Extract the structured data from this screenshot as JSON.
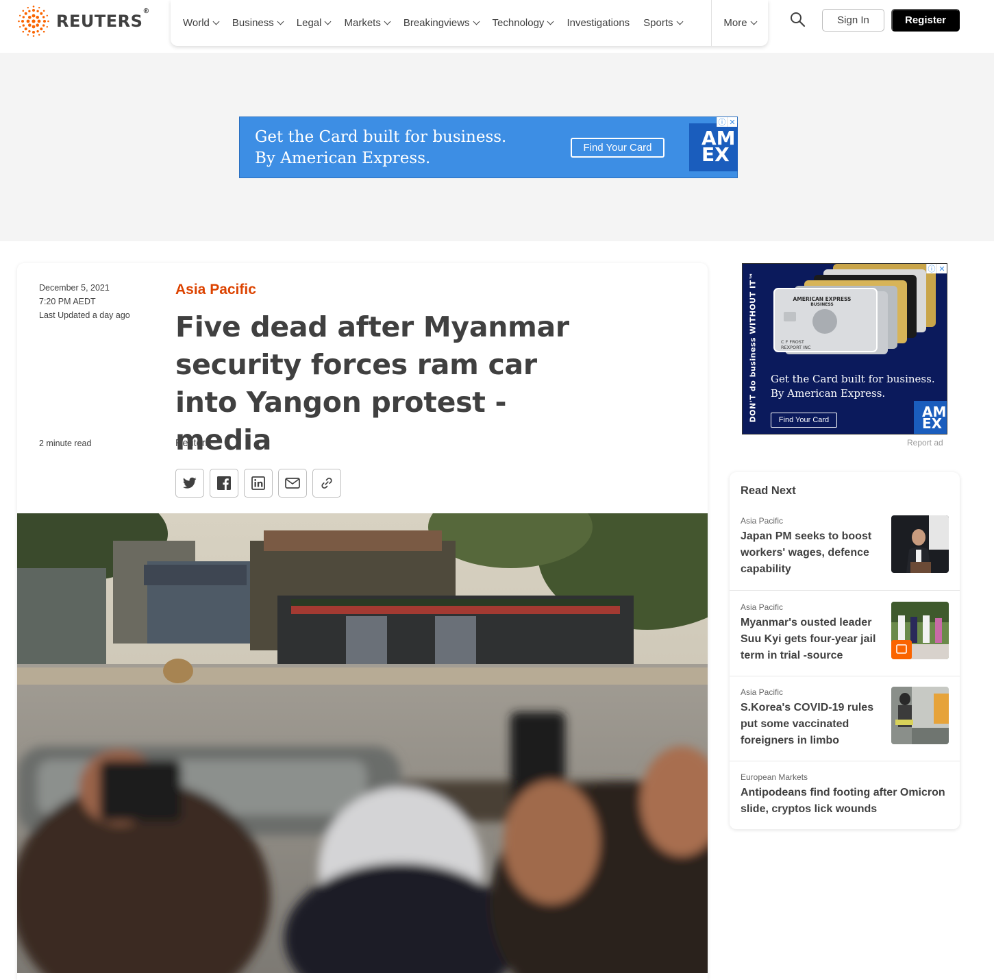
{
  "header": {
    "brand": "REUTERS",
    "brand_mark": "®",
    "nav": [
      "World",
      "Business",
      "Legal",
      "Markets",
      "Breakingviews",
      "Technology",
      "Investigations",
      "Sports"
    ],
    "nav_chevrons": [
      true,
      true,
      true,
      true,
      true,
      true,
      false,
      true
    ],
    "more_label": "More",
    "sign_in": "Sign In",
    "register": "Register"
  },
  "top_ad": {
    "line1": "Get the Card built for business.",
    "line2": "By American Express.",
    "cta": "Find Your Card",
    "logo_line1": "AM",
    "logo_line2": "EX"
  },
  "article": {
    "date": "December 5, 2021",
    "time": "7:20 PM AEDT",
    "updated": "Last Updated a day ago",
    "kicker": "Asia Pacific",
    "headline": "Five dead after Myanmar security forces ram car into Yangon protest - media",
    "read_time": "2 minute read",
    "byline": "Reuters",
    "share": [
      "twitter-icon",
      "facebook-icon",
      "linkedin-icon",
      "email-icon",
      "link-icon"
    ]
  },
  "side_ad": {
    "vertical_tagline": "DON'T do business WITHOUT IT™",
    "line1": "Get the Card built for business.",
    "line2": "By American Express.",
    "cta": "Find Your Card",
    "logo_line1": "AM",
    "logo_line2": "EX",
    "card_issuer": "AMERICAN EXPRESS",
    "card_type": "BUSINESS",
    "card_name": "C F FROST",
    "card_company": "REXPORT INC",
    "report": "Report ad"
  },
  "read_next": {
    "title": "Read Next",
    "items": [
      {
        "category": "Asia Pacific",
        "headline": "Japan PM seeks to boost workers' wages, defence capability"
      },
      {
        "category": "Asia Pacific",
        "headline": "Myanmar's ousted leader Suu Kyi gets four-year jail term in trial -source"
      },
      {
        "category": "Asia Pacific",
        "headline": "S.Korea's COVID-19 rules put some vaccinated foreigners in limbo"
      },
      {
        "category": "European Markets",
        "headline": "Antipodeans find footing after Omicron slide, cryptos lick wounds"
      }
    ]
  },
  "colors": {
    "accent_orange": "#dc4300",
    "text": "#404040",
    "amex_blue": "#3d8ee4",
    "amex_navy": "#0b1a5c"
  }
}
